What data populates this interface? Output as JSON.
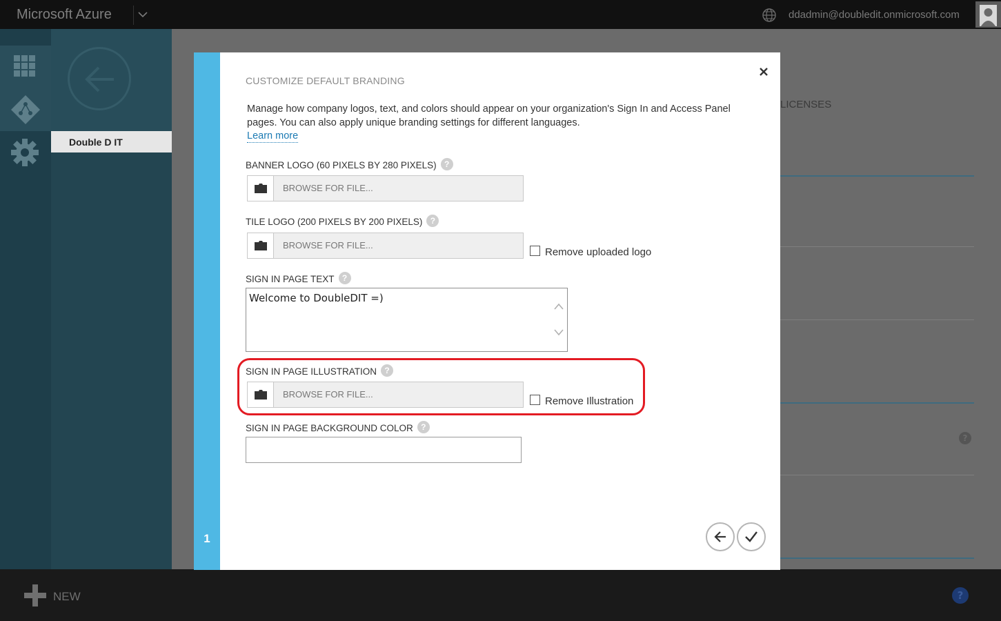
{
  "topbar": {
    "brand": "Microsoft Azure",
    "user_email": "ddadmin@doubledit.onmicrosoft.com"
  },
  "nav2": {
    "directory_name": "Double D IT"
  },
  "background": {
    "licenses_tab": "LICENSES"
  },
  "bottombar": {
    "new_label": "NEW",
    "help": "?"
  },
  "modal": {
    "title": "CUSTOMIZE DEFAULT BRANDING",
    "description": "Manage how company logos, text, and colors should appear on your organization's Sign In and Access Panel pages. You can also apply unique branding settings for different languages.",
    "learn_more": "Learn more",
    "step": "1",
    "banner_logo": {
      "label": "BANNER LOGO (60 PIXELS BY 280 PIXELS)",
      "browse": "BROWSE FOR FILE..."
    },
    "tile_logo": {
      "label": "TILE LOGO (200 PIXELS BY 200 PIXELS)",
      "browse": "BROWSE FOR FILE...",
      "remove_label": "Remove uploaded logo"
    },
    "sign_in_text": {
      "label": "SIGN IN PAGE TEXT",
      "value": "Welcome to DoubleDIT =)"
    },
    "sign_in_illustration": {
      "label": "SIGN IN PAGE ILLUSTRATION",
      "browse": "BROWSE FOR FILE...",
      "remove_label": "Remove Illustration"
    },
    "background_color": {
      "label": "SIGN IN PAGE BACKGROUND COLOR",
      "value": ""
    },
    "help_glyph": "?"
  },
  "colors": {
    "modal_accent": "#4fb8e4",
    "highlight": "#e31b23",
    "link": "#1b7ab3"
  }
}
